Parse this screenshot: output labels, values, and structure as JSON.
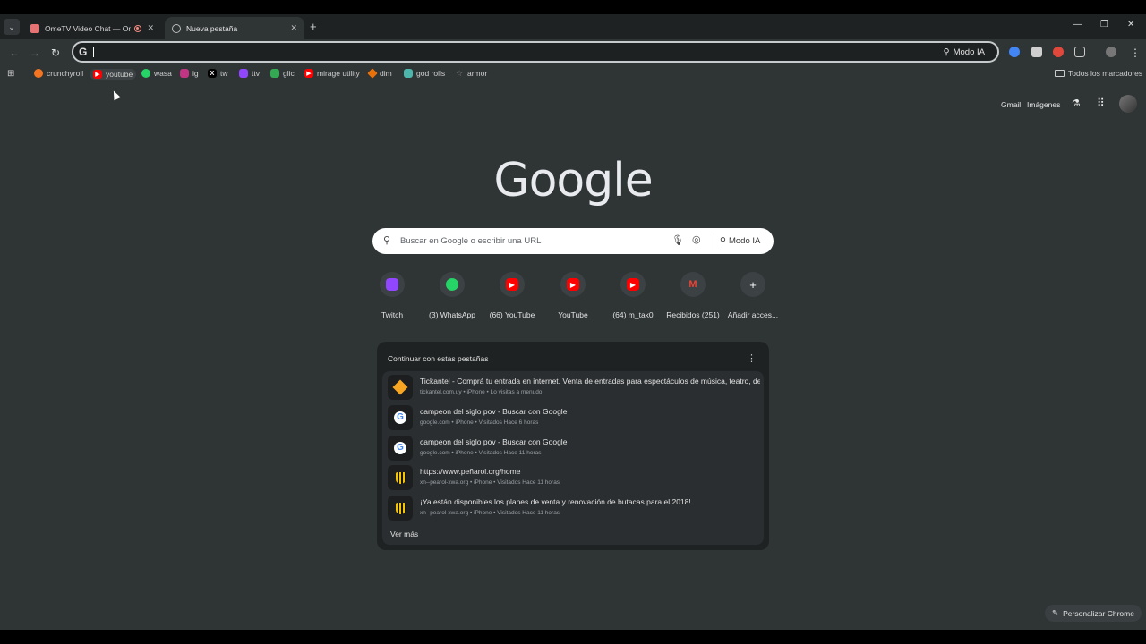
{
  "tabs": [
    {
      "title": "OmeTV Video Chat — Ome",
      "favicon": "ometv-icon",
      "recording": true
    },
    {
      "title": "Nueva pestaña",
      "favicon": "chrome-newtab-icon"
    }
  ],
  "omnibox": {
    "value": "",
    "ai_label": "Modo IA"
  },
  "bookmarks": [
    {
      "label": "crunchyroll",
      "color": "#f47521"
    },
    {
      "label": "youtube",
      "color": "#ff0000"
    },
    {
      "label": "wasa",
      "color": "#25d366"
    },
    {
      "label": "ig",
      "color": "#c13584"
    },
    {
      "label": "tw",
      "color": "#000000"
    },
    {
      "label": "ttv",
      "color": "#9146ff"
    },
    {
      "label": "glic",
      "color": "#34a853"
    },
    {
      "label": "mirage utility",
      "color": "#ff0000"
    },
    {
      "label": "dim",
      "color": "#e8710a"
    },
    {
      "label": "god rolls",
      "color": "#4db6ac"
    },
    {
      "label": "armor",
      "color": "#888888"
    }
  ],
  "all_bookmarks_label": "Todos los marcadores",
  "top_links": {
    "gmail": "Gmail",
    "images": "Imágenes"
  },
  "logo": "Google",
  "search": {
    "placeholder": "Buscar en Google o escribir una URL",
    "ai_label": "Modo IA"
  },
  "shortcuts": [
    {
      "label": "Twitch",
      "icon": "twitch-icon",
      "color": "#9146ff"
    },
    {
      "label": "(3) WhatsApp",
      "icon": "whatsapp-icon",
      "color": "#25d366"
    },
    {
      "label": "(66) YouTube",
      "icon": "youtube-icon",
      "color": "#ff0000"
    },
    {
      "label": "YouTube",
      "icon": "youtube-icon",
      "color": "#ff0000"
    },
    {
      "label": "(64) m_tak0",
      "icon": "youtube-icon",
      "color": "#ff0000"
    },
    {
      "label": "Recibidos (251)",
      "icon": "gmail-icon",
      "color": "#ea4335"
    },
    {
      "label": "Añadir acces...",
      "icon": "plus-icon",
      "color": "#3c4144"
    }
  ],
  "continue_card": {
    "title": "Continuar con estas pestañas",
    "items": [
      {
        "title": "Tickantel - Comprá tu entrada en internet. Venta de entradas para espectáculos de música, teatro, deportes, ...",
        "meta": "tickantel.com.uy • iPhone • Lo visitas a menudo",
        "icon": "tickantel-icon"
      },
      {
        "title": "campeon del siglo pov - Buscar con Google",
        "meta": "google.com • iPhone • Visitados Hace 6 horas",
        "icon": "google-icon"
      },
      {
        "title": "campeon del siglo pov - Buscar con Google",
        "meta": "google.com • iPhone • Visitados Hace 11 horas",
        "icon": "google-icon"
      },
      {
        "title": "https://www.peñarol.org/home",
        "meta": "xn--pearol-xwa.org • iPhone • Visitados Hace 11 horas",
        "icon": "penarol-icon"
      },
      {
        "title": "¡Ya están disponibles los planes de venta y renovación de butacas para el 2018!",
        "meta": "xn--pearol-xwa.org • iPhone • Visitados Hace 11 horas",
        "icon": "penarol-icon"
      }
    ],
    "more_label": "Ver más"
  },
  "personalize_label": "Personalizar Chrome"
}
